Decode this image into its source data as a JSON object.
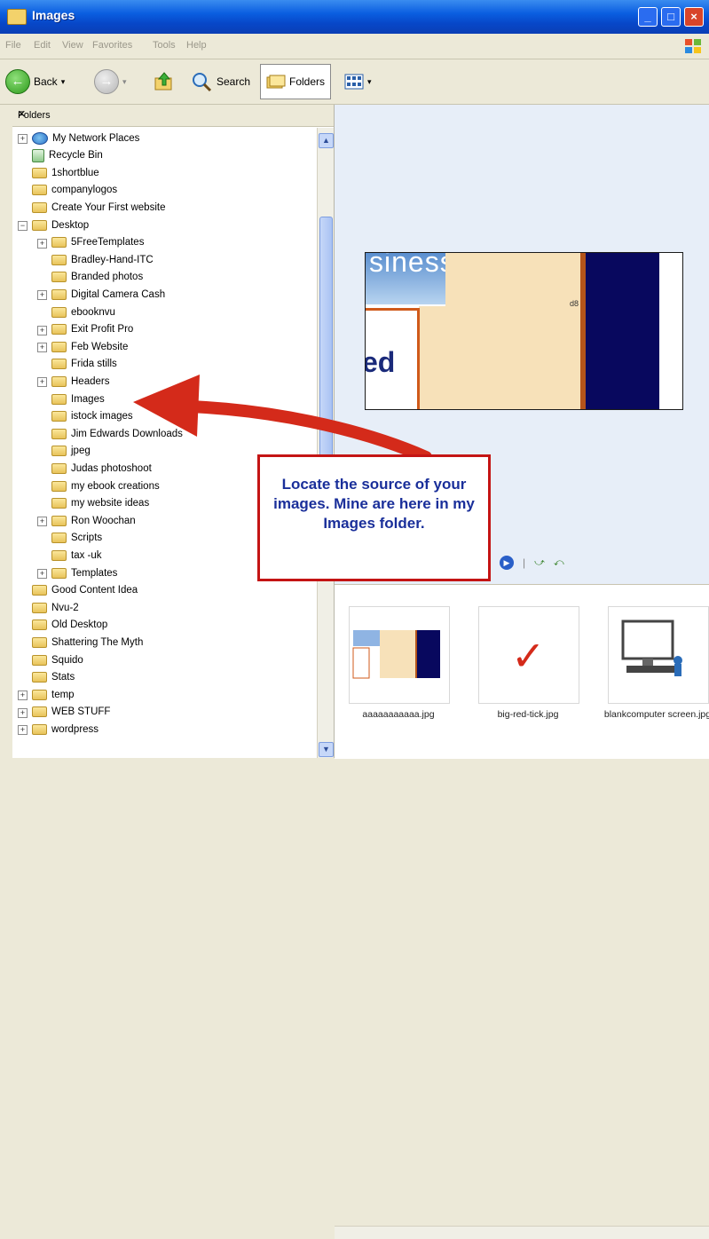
{
  "window": {
    "title": "Images"
  },
  "menu": [
    "File",
    "Edit",
    "View",
    "Favorites",
    "Tools",
    "Help"
  ],
  "toolbar": {
    "back": "Back",
    "search": "Search",
    "folders": "Folders"
  },
  "left_pane": {
    "header": "Folders",
    "close": "×",
    "items": [
      {
        "label": "My Network Places",
        "icon": "network-icon",
        "expander": "+"
      },
      {
        "label": "Recycle Bin",
        "icon": "recycle-bin-icon",
        "expander": ""
      },
      {
        "label": "1shortblue",
        "icon": "folder-icon",
        "expander": ""
      },
      {
        "label": "companylogos",
        "icon": "folder-icon",
        "expander": ""
      },
      {
        "label": "Create Your First website",
        "icon": "folder-icon",
        "expander": ""
      },
      {
        "label": "Desktop",
        "icon": "folder-icon",
        "expander": "−"
      },
      {
        "label": "5FreeTemplates",
        "icon": "folder-icon",
        "expander": "+"
      },
      {
        "label": "Bradley-Hand-ITC",
        "icon": "folder-icon",
        "expander": ""
      },
      {
        "label": "Branded photos",
        "icon": "folder-icon",
        "expander": ""
      },
      {
        "label": "Digital Camera Cash",
        "icon": "folder-icon",
        "expander": "+"
      },
      {
        "label": "ebooknvu",
        "icon": "folder-icon",
        "expander": ""
      },
      {
        "label": "Exit Profit Pro",
        "icon": "folder-icon",
        "expander": "+"
      },
      {
        "label": "Feb Website",
        "icon": "folder-icon",
        "expander": "+"
      },
      {
        "label": "Frida stills",
        "icon": "folder-icon",
        "expander": ""
      },
      {
        "label": "Headers",
        "icon": "folder-icon",
        "expander": "+"
      },
      {
        "label": "Images",
        "icon": "folder-icon",
        "expander": ""
      },
      {
        "label": "istock images",
        "icon": "folder-icon",
        "expander": ""
      },
      {
        "label": "Jim Edwards Downloads",
        "icon": "folder-icon",
        "expander": ""
      },
      {
        "label": "jpeg",
        "icon": "folder-icon",
        "expander": ""
      },
      {
        "label": "Judas photoshoot",
        "icon": "folder-icon",
        "expander": ""
      },
      {
        "label": "my ebook creations",
        "icon": "folder-icon",
        "expander": ""
      },
      {
        "label": "my website ideas",
        "icon": "folder-icon",
        "expander": ""
      },
      {
        "label": "Ron Woochan",
        "icon": "folder-icon",
        "expander": "+"
      },
      {
        "label": "Scripts",
        "icon": "folder-icon",
        "expander": ""
      },
      {
        "label": "tax -uk",
        "icon": "folder-icon",
        "expander": ""
      },
      {
        "label": "Templates",
        "icon": "folder-icon",
        "expander": "+"
      },
      {
        "label": "Good Content Idea",
        "icon": "folder-icon",
        "expander": ""
      },
      {
        "label": "Nvu-2",
        "icon": "folder-icon",
        "expander": ""
      },
      {
        "label": "Old Desktop",
        "icon": "folder-icon",
        "expander": ""
      },
      {
        "label": "Shattering The Myth",
        "icon": "folder-icon",
        "expander": ""
      },
      {
        "label": "Squido",
        "icon": "folder-icon",
        "expander": ""
      },
      {
        "label": "Stats",
        "icon": "folder-icon",
        "expander": ""
      },
      {
        "label": "temp",
        "icon": "folder-icon",
        "expander": "+"
      },
      {
        "label": "WEB STUFF",
        "icon": "folder-icon",
        "expander": "+"
      },
      {
        "label": "wordpress",
        "icon": "folder-icon",
        "expander": "+"
      }
    ]
  },
  "preview": {
    "text_top": "siness",
    "text_left": "ed",
    "tag": "d8"
  },
  "thumbnails": [
    {
      "label": "aaaaaaaaaaa.jpg"
    },
    {
      "label": "big-red-tick.jpg"
    },
    {
      "label": "blankcomputer screen.jpg"
    }
  ],
  "callout": {
    "text": "Locate the source of your images.  Mine are here in my Images folder."
  },
  "colors": {
    "titlebar": "#0a5ee0",
    "callout_border": "#c41414",
    "callout_text": "#1a2f9a",
    "arrow": "#d42a1a"
  }
}
